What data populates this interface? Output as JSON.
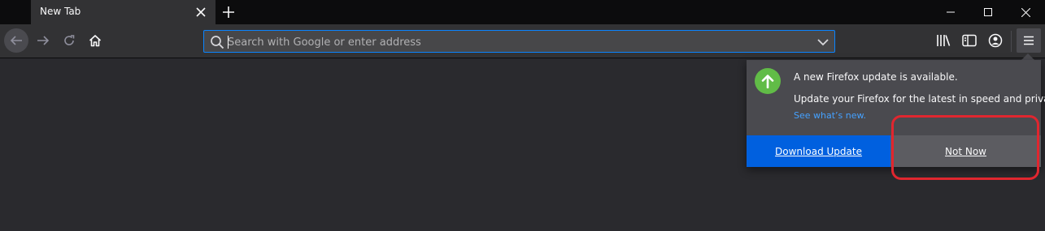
{
  "tab": {
    "title": "New Tab"
  },
  "urlbar": {
    "placeholder": "Search with Google or enter address"
  },
  "toolbar_icons": [
    "back-arrow-icon",
    "forward-arrow-icon",
    "reload-icon",
    "home-icon",
    "search-icon",
    "chevron-down-icon",
    "library-icon",
    "sidebar-icon",
    "account-icon",
    "hamburger-menu-icon"
  ],
  "window_controls": [
    "minimize-icon",
    "maximize-icon",
    "close-icon"
  ],
  "update_panel": {
    "title": "A new Firefox update is available.",
    "description": "Update your Firefox for the latest in speed and privacy.",
    "link": "See what’s new.",
    "primary_button": "Download Update",
    "secondary_button": "Not Now"
  },
  "colors": {
    "accent": "#0a84ff",
    "primary_button": "#0060df",
    "update_icon": "#61bc47",
    "link": "#45a1ff",
    "annotation": "#e0262f"
  }
}
